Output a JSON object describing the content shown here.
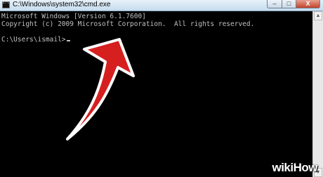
{
  "window": {
    "title": "C:\\Windows\\system32\\cmd.exe",
    "controls": {
      "minimize": "–",
      "maximize": "□",
      "close": "X"
    }
  },
  "console": {
    "lines": [
      "Microsoft Windows [Version 6.1.7600]",
      "Copyright (c) 2009 Microsoft Corporation.  All rights reserved.",
      "",
      "C:\\Users\\ismail>"
    ]
  },
  "annotation": {
    "icon": "red-curved-arrow-icon",
    "color": "#d61f1f"
  },
  "watermark": {
    "text": "wikiHow"
  },
  "colors": {
    "console_bg": "#000000",
    "console_text": "#c0c0c0"
  }
}
